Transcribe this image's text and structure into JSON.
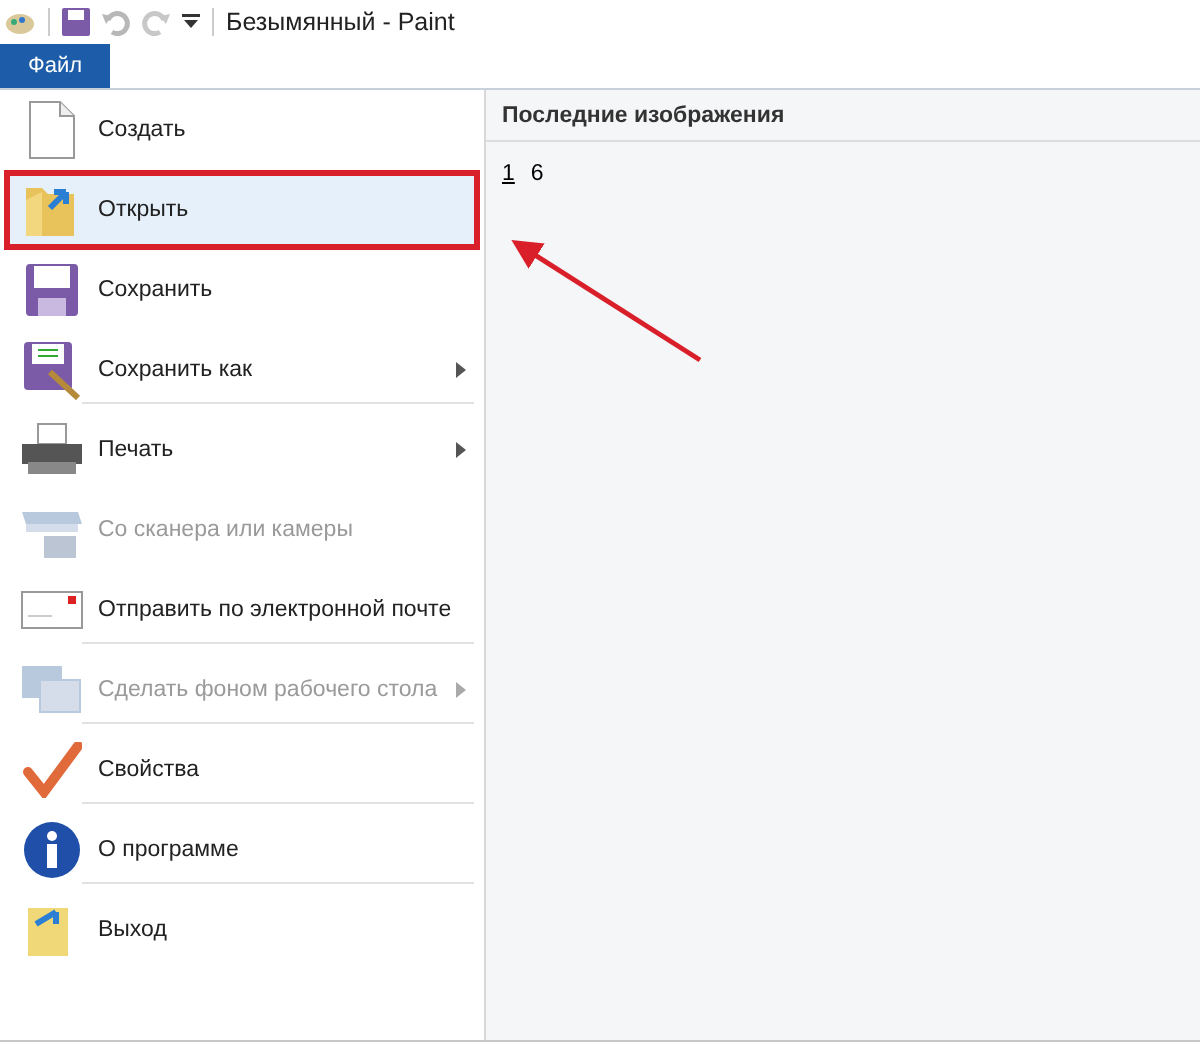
{
  "window": {
    "title": "Безымянный - Paint"
  },
  "ribbon_tabs": [
    {
      "label": "Файл",
      "selected": true
    }
  ],
  "menu": [
    {
      "label": "Создать",
      "disabled": false,
      "selected": false,
      "submenu": false,
      "separator_after": false
    },
    {
      "label": "Открыть",
      "disabled": false,
      "selected": true,
      "submenu": false,
      "separator_after": false
    },
    {
      "label": "Сохранить",
      "disabled": false,
      "selected": false,
      "submenu": false,
      "separator_after": false
    },
    {
      "label": "Сохранить как",
      "disabled": false,
      "selected": false,
      "submenu": true,
      "separator_after": true
    },
    {
      "label": "Печать",
      "disabled": false,
      "selected": false,
      "submenu": true,
      "separator_after": false
    },
    {
      "label": "Со сканера или камеры",
      "disabled": true,
      "selected": false,
      "submenu": false,
      "separator_after": false
    },
    {
      "label": "Отправить по электронной почте",
      "disabled": false,
      "selected": false,
      "submenu": false,
      "separator_after": true
    },
    {
      "label": "Сделать фоном рабочего стола",
      "disabled": true,
      "selected": false,
      "submenu": true,
      "separator_after": true
    },
    {
      "label": "Свойства",
      "disabled": false,
      "selected": false,
      "submenu": false,
      "separator_after": true
    },
    {
      "label": "О программе",
      "disabled": false,
      "selected": false,
      "submenu": false,
      "separator_after": true
    },
    {
      "label": "Выход",
      "disabled": false,
      "selected": false,
      "submenu": false,
      "separator_after": false
    }
  ],
  "recent": {
    "title": "Последние изображения",
    "items": [
      {
        "number": "1",
        "name": "6"
      }
    ]
  }
}
